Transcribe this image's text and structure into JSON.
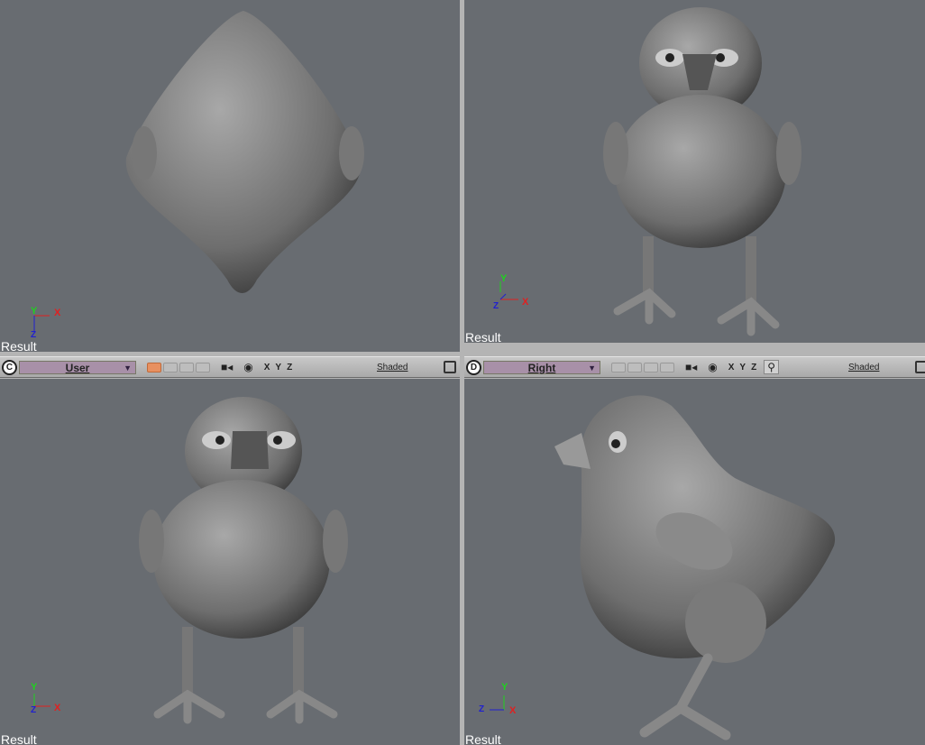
{
  "viewports": [
    {
      "id": "top-left",
      "result_label": "Result",
      "axes": [
        "Y",
        "X",
        "Z"
      ]
    },
    {
      "id": "top-right",
      "result_label": "Result",
      "axes": [
        "Y",
        "X",
        "Z"
      ]
    },
    {
      "id": "bottom-left",
      "letter": "C",
      "view": "User",
      "result_label": "Result",
      "shading": "Shaded",
      "axes": [
        "Y",
        "X",
        "Z"
      ]
    },
    {
      "id": "bottom-right",
      "letter": "D",
      "view": "Right",
      "result_label": "Result",
      "shading": "Shaded",
      "axes": [
        "Y",
        "X",
        "Z"
      ]
    }
  ],
  "colors": {
    "viewport_bg": "#686c71",
    "x_axis": "#e02020",
    "y_axis": "#20d020",
    "z_axis": "#2020d0",
    "view_select": "#a890a8"
  },
  "icons": [
    "camera-icon",
    "eye-icon",
    "zoom-icon",
    "maximize-icon"
  ]
}
